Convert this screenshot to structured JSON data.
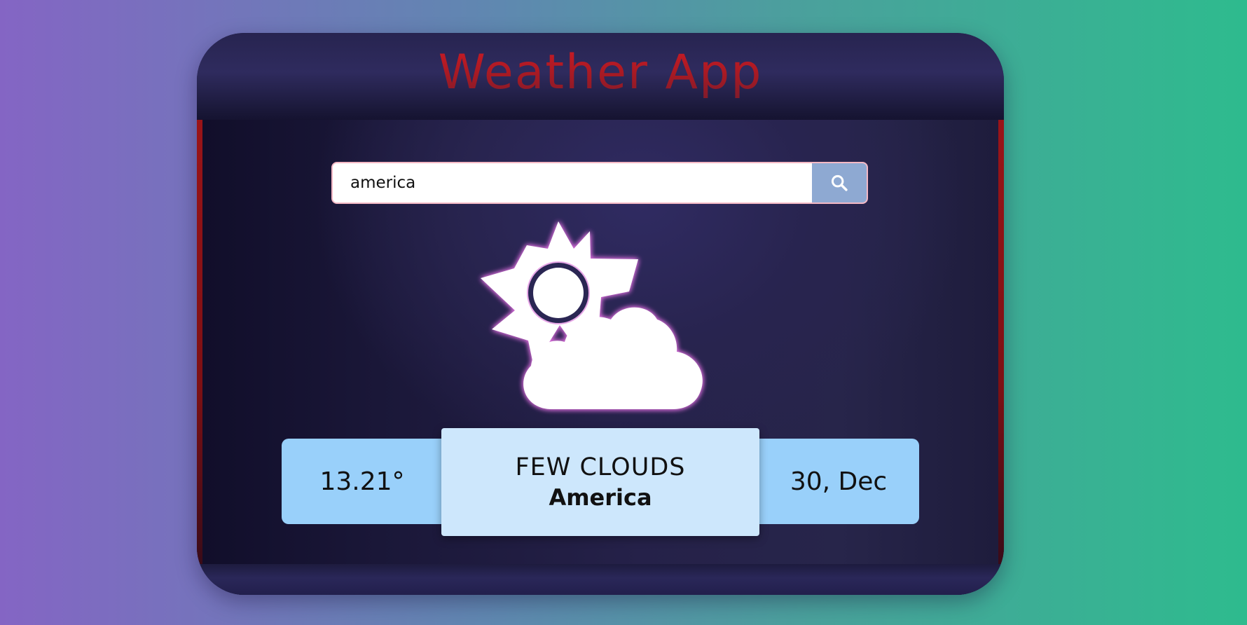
{
  "app": {
    "title": "Weather App"
  },
  "search": {
    "value": "america",
    "icon": "search-icon"
  },
  "weather": {
    "icon": "partly-cloudy-icon",
    "temperature": "13.21°",
    "description": "FEW CLOUDS",
    "city": "America",
    "date": "30, Dec"
  },
  "colors": {
    "title": "#a8171f",
    "card": "#99d0fa",
    "card_center": "#cde7fc",
    "search_button": "#8ea9d2",
    "search_border": "#f4b8c4"
  }
}
